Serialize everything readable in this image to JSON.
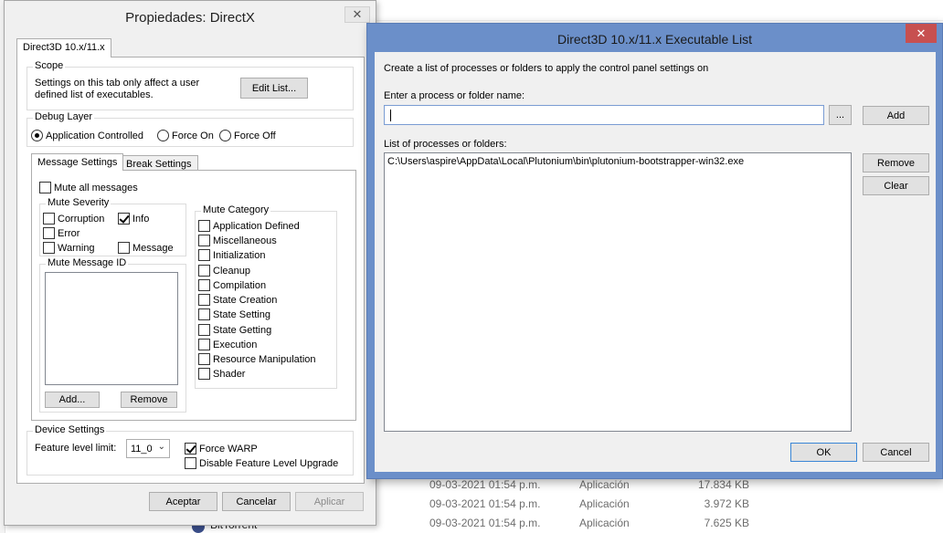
{
  "background": {
    "rows": [
      {
        "date": "09-03-2021 01:54 p.m.",
        "type": "Aplicación",
        "size": "17.834 KB"
      },
      {
        "date": "09-03-2021 01:54 p.m.",
        "type": "Aplicación",
        "size": "3.972 KB"
      },
      {
        "date": "09-03-2021 01:54 p.m.",
        "type": "Aplicación",
        "size": "7.625 KB"
      }
    ],
    "bottom_item": "BitTorrent"
  },
  "dx_window": {
    "title": "Propiedades: DirectX",
    "close_glyph": "✕",
    "main_tab": "Direct3D 10.x/11.x",
    "scope": {
      "label": "Scope",
      "description_line1": "Settings on this tab only affect a user",
      "description_line2": "defined list of executables.",
      "edit_list_button": "Edit List..."
    },
    "debug_layer": {
      "label": "Debug Layer",
      "options": [
        "Application Controlled",
        "Force On",
        "Force Off"
      ],
      "selected": "Application Controlled"
    },
    "sub_tabs": [
      "Message Settings",
      "Break Settings"
    ],
    "mute_all": {
      "label": "Mute all messages",
      "checked": false
    },
    "mute_severity": {
      "label": "Mute Severity",
      "items": [
        {
          "label": "Corruption",
          "checked": false
        },
        {
          "label": "Info",
          "checked": true
        },
        {
          "label": "Error",
          "checked": false
        },
        {
          "label": "Warning",
          "checked": false
        },
        {
          "label": "Message",
          "checked": false
        }
      ]
    },
    "mute_category": {
      "label": "Mute Category",
      "items": [
        "Application Defined",
        "Miscellaneous",
        "Initialization",
        "Cleanup",
        "Compilation",
        "State Creation",
        "State Setting",
        "State Getting",
        "Execution",
        "Resource Manipulation",
        "Shader"
      ]
    },
    "mute_message_id": {
      "label": "Mute Message ID",
      "add_button": "Add...",
      "remove_button": "Remove"
    },
    "device_settings": {
      "label": "Device Settings",
      "feature_level_label": "Feature level limit:",
      "feature_level_value": "11_0",
      "force_warp": {
        "label": "Force WARP",
        "checked": true
      },
      "disable_upgrade": {
        "label": "Disable Feature Level Upgrade",
        "checked": false
      }
    },
    "buttons": {
      "accept": "Aceptar",
      "cancel": "Cancelar",
      "apply": "Aplicar"
    }
  },
  "exe_window": {
    "title": "Direct3D 10.x/11.x Executable List",
    "close_glyph": "✕",
    "instructions": "Create a list of processes or folders to apply the control panel settings on",
    "name_label": "Enter a process or folder name:",
    "name_value": "",
    "browse_button": "...",
    "add_button": "Add",
    "list_label": "List of processes or folders:",
    "list_items": [
      "C:\\Users\\aspire\\AppData\\Local\\Plutonium\\bin\\plutonium-bootstrapper-win32.exe"
    ],
    "remove_button": "Remove",
    "clear_button": "Clear",
    "ok_button": "OK",
    "cancel_button": "Cancel"
  },
  "colors": {
    "window_frame_active": "#6b8fc9",
    "close_button": "#c75050",
    "dialog_face": "#f0f0f0"
  }
}
